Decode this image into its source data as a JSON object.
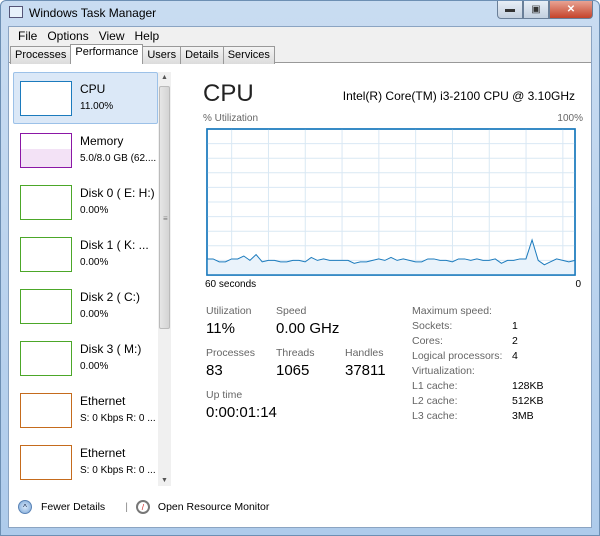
{
  "window": {
    "title": "Windows Task Manager",
    "buttons": [
      "minimize",
      "maximize",
      "close"
    ]
  },
  "menu": [
    "File",
    "Options",
    "View",
    "Help"
  ],
  "tabs": [
    {
      "label": "Processes"
    },
    {
      "label": "Performance",
      "active": true
    },
    {
      "label": "Users"
    },
    {
      "label": "Details"
    },
    {
      "label": "Services"
    }
  ],
  "sidebar": [
    {
      "name": "CPU",
      "value": "11.00%",
      "color": "#1c7bbd",
      "selected": true
    },
    {
      "name": "Memory",
      "value": "5.0/8.0 GB (62....",
      "color": "#8b17a6"
    },
    {
      "name": "Disk 0 ( E: H:)",
      "value": "0.00%",
      "color": "#4ca729"
    },
    {
      "name": "Disk 1 ( K: ...",
      "value": "0.00%",
      "color": "#4ca729"
    },
    {
      "name": "Disk 2 ( C:)",
      "value": "0.00%",
      "color": "#4ca729"
    },
    {
      "name": "Disk 3 ( M:)",
      "value": "0.00%",
      "color": "#4ca729"
    },
    {
      "name": "Ethernet",
      "value": "S: 0 Kbps R: 0 ...",
      "color": "#c56b1d"
    },
    {
      "name": "Ethernet",
      "value": "S: 0 Kbps R: 0 ...",
      "color": "#c56b1d"
    }
  ],
  "main": {
    "title": "CPU",
    "model": "Intel(R) Core(TM) i3-2100 CPU @ 3.10GHz",
    "graph_label": "% Utilization",
    "graph_max": "100%",
    "graph_left": "60 seconds",
    "graph_right": "0",
    "stats": {
      "utilization_label": "Utilization",
      "utilization": "11%",
      "speed_label": "Speed",
      "speed": "0.00 GHz",
      "processes_label": "Processes",
      "processes": "83",
      "threads_label": "Threads",
      "threads": "1065",
      "handles_label": "Handles",
      "handles": "37811",
      "uptime_label": "Up time",
      "uptime": "0:00:01:14"
    },
    "specs": [
      {
        "k": "Maximum speed:",
        "v": ""
      },
      {
        "k": "Sockets:",
        "v": "1"
      },
      {
        "k": "Cores:",
        "v": "2"
      },
      {
        "k": "Logical processors:",
        "v": "4"
      },
      {
        "k": "Virtualization:",
        "v": ""
      },
      {
        "k": "L1 cache:",
        "v": "128KB"
      },
      {
        "k": "L2 cache:",
        "v": "512KB"
      },
      {
        "k": "L3 cache:",
        "v": "3MB"
      }
    ]
  },
  "footer": {
    "fewer_details": "Fewer Details",
    "open_resource_monitor": "Open Resource Monitor"
  },
  "chart_data": {
    "type": "area",
    "title": "% Utilization",
    "xlabel": "60 seconds",
    "ylim": [
      0,
      100
    ],
    "values": [
      11,
      11,
      9,
      9,
      11,
      11,
      13,
      10,
      14,
      9,
      10,
      10,
      9,
      9,
      10,
      10,
      9,
      12,
      10,
      11,
      10,
      10,
      10,
      10,
      8,
      9,
      9,
      10,
      11,
      10,
      12,
      10,
      11,
      10,
      9,
      9,
      11,
      11,
      10,
      10,
      9,
      11,
      11,
      10,
      11,
      10,
      10,
      11,
      8,
      10,
      10,
      11,
      11,
      24,
      10,
      7,
      9,
      11,
      10,
      9,
      10
    ],
    "line_color": "#1c7bbd",
    "fill_color": "#eaf3fb"
  }
}
